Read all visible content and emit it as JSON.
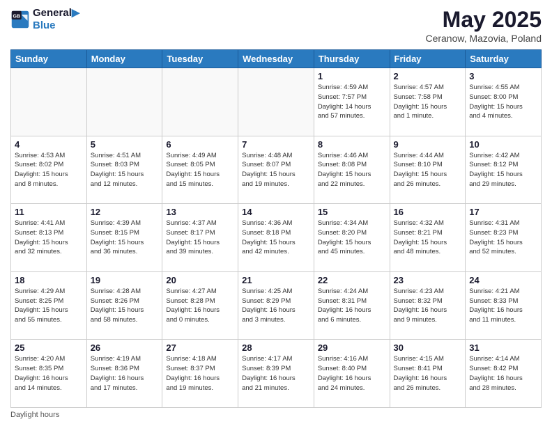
{
  "logo": {
    "line1": "General",
    "line2": "Blue"
  },
  "title": "May 2025",
  "subtitle": "Ceranow, Mazovia, Poland",
  "days_of_week": [
    "Sunday",
    "Monday",
    "Tuesday",
    "Wednesday",
    "Thursday",
    "Friday",
    "Saturday"
  ],
  "footer": "Daylight hours",
  "weeks": [
    [
      {
        "day": "",
        "info": ""
      },
      {
        "day": "",
        "info": ""
      },
      {
        "day": "",
        "info": ""
      },
      {
        "day": "",
        "info": ""
      },
      {
        "day": "1",
        "info": "Sunrise: 4:59 AM\nSunset: 7:57 PM\nDaylight: 14 hours\nand 57 minutes."
      },
      {
        "day": "2",
        "info": "Sunrise: 4:57 AM\nSunset: 7:58 PM\nDaylight: 15 hours\nand 1 minute."
      },
      {
        "day": "3",
        "info": "Sunrise: 4:55 AM\nSunset: 8:00 PM\nDaylight: 15 hours\nand 4 minutes."
      }
    ],
    [
      {
        "day": "4",
        "info": "Sunrise: 4:53 AM\nSunset: 8:02 PM\nDaylight: 15 hours\nand 8 minutes."
      },
      {
        "day": "5",
        "info": "Sunrise: 4:51 AM\nSunset: 8:03 PM\nDaylight: 15 hours\nand 12 minutes."
      },
      {
        "day": "6",
        "info": "Sunrise: 4:49 AM\nSunset: 8:05 PM\nDaylight: 15 hours\nand 15 minutes."
      },
      {
        "day": "7",
        "info": "Sunrise: 4:48 AM\nSunset: 8:07 PM\nDaylight: 15 hours\nand 19 minutes."
      },
      {
        "day": "8",
        "info": "Sunrise: 4:46 AM\nSunset: 8:08 PM\nDaylight: 15 hours\nand 22 minutes."
      },
      {
        "day": "9",
        "info": "Sunrise: 4:44 AM\nSunset: 8:10 PM\nDaylight: 15 hours\nand 26 minutes."
      },
      {
        "day": "10",
        "info": "Sunrise: 4:42 AM\nSunset: 8:12 PM\nDaylight: 15 hours\nand 29 minutes."
      }
    ],
    [
      {
        "day": "11",
        "info": "Sunrise: 4:41 AM\nSunset: 8:13 PM\nDaylight: 15 hours\nand 32 minutes."
      },
      {
        "day": "12",
        "info": "Sunrise: 4:39 AM\nSunset: 8:15 PM\nDaylight: 15 hours\nand 36 minutes."
      },
      {
        "day": "13",
        "info": "Sunrise: 4:37 AM\nSunset: 8:17 PM\nDaylight: 15 hours\nand 39 minutes."
      },
      {
        "day": "14",
        "info": "Sunrise: 4:36 AM\nSunset: 8:18 PM\nDaylight: 15 hours\nand 42 minutes."
      },
      {
        "day": "15",
        "info": "Sunrise: 4:34 AM\nSunset: 8:20 PM\nDaylight: 15 hours\nand 45 minutes."
      },
      {
        "day": "16",
        "info": "Sunrise: 4:32 AM\nSunset: 8:21 PM\nDaylight: 15 hours\nand 48 minutes."
      },
      {
        "day": "17",
        "info": "Sunrise: 4:31 AM\nSunset: 8:23 PM\nDaylight: 15 hours\nand 52 minutes."
      }
    ],
    [
      {
        "day": "18",
        "info": "Sunrise: 4:29 AM\nSunset: 8:25 PM\nDaylight: 15 hours\nand 55 minutes."
      },
      {
        "day": "19",
        "info": "Sunrise: 4:28 AM\nSunset: 8:26 PM\nDaylight: 15 hours\nand 58 minutes."
      },
      {
        "day": "20",
        "info": "Sunrise: 4:27 AM\nSunset: 8:28 PM\nDaylight: 16 hours\nand 0 minutes."
      },
      {
        "day": "21",
        "info": "Sunrise: 4:25 AM\nSunset: 8:29 PM\nDaylight: 16 hours\nand 3 minutes."
      },
      {
        "day": "22",
        "info": "Sunrise: 4:24 AM\nSunset: 8:31 PM\nDaylight: 16 hours\nand 6 minutes."
      },
      {
        "day": "23",
        "info": "Sunrise: 4:23 AM\nSunset: 8:32 PM\nDaylight: 16 hours\nand 9 minutes."
      },
      {
        "day": "24",
        "info": "Sunrise: 4:21 AM\nSunset: 8:33 PM\nDaylight: 16 hours\nand 11 minutes."
      }
    ],
    [
      {
        "day": "25",
        "info": "Sunrise: 4:20 AM\nSunset: 8:35 PM\nDaylight: 16 hours\nand 14 minutes."
      },
      {
        "day": "26",
        "info": "Sunrise: 4:19 AM\nSunset: 8:36 PM\nDaylight: 16 hours\nand 17 minutes."
      },
      {
        "day": "27",
        "info": "Sunrise: 4:18 AM\nSunset: 8:37 PM\nDaylight: 16 hours\nand 19 minutes."
      },
      {
        "day": "28",
        "info": "Sunrise: 4:17 AM\nSunset: 8:39 PM\nDaylight: 16 hours\nand 21 minutes."
      },
      {
        "day": "29",
        "info": "Sunrise: 4:16 AM\nSunset: 8:40 PM\nDaylight: 16 hours\nand 24 minutes."
      },
      {
        "day": "30",
        "info": "Sunrise: 4:15 AM\nSunset: 8:41 PM\nDaylight: 16 hours\nand 26 minutes."
      },
      {
        "day": "31",
        "info": "Sunrise: 4:14 AM\nSunset: 8:42 PM\nDaylight: 16 hours\nand 28 minutes."
      }
    ]
  ]
}
